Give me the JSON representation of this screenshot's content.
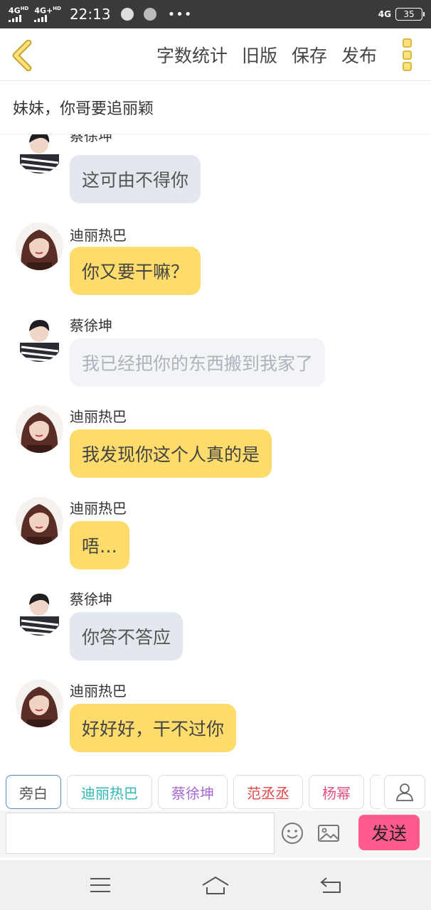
{
  "status_bar": {
    "net1": "4G",
    "net1_sup": "HD",
    "net2": "4G+",
    "net2_sup": "HD",
    "time": "22:13",
    "net3": "4G",
    "battery": "35"
  },
  "toolbar": {
    "word_count": "字数统计",
    "old_version": "旧版",
    "save": "保存",
    "publish": "发布"
  },
  "chat_title": "妹妹，你哥要追丽颖",
  "colors": {
    "yellow_bubble": "#fddc6c",
    "gray_bubble": "#e3e8ef",
    "send_button": "#ff5c8d",
    "role_dilireba": "#2fb8b4",
    "role_caixukun": "#a86ad0",
    "role_fanchengcheng": "#e04747",
    "role_yangmi": "#e0527c"
  },
  "messages": [
    {
      "sender": "蔡徐坤",
      "text": "这可由不得你",
      "style": "gray",
      "avatar": "male-avatar"
    },
    {
      "sender": "迪丽热巴",
      "text": "你又要干嘛？",
      "style": "yellow",
      "avatar": "female-avatar"
    },
    {
      "sender": "蔡徐坤",
      "text": "我已经把你的东西搬到我家了",
      "style": "faint",
      "avatar": "male-avatar"
    },
    {
      "sender": "迪丽热巴",
      "text": "我发现你这个人真的是",
      "style": "yellow",
      "avatar": "female-avatar"
    },
    {
      "sender": "迪丽热巴",
      "text": "唔…",
      "style": "yellow",
      "avatar": "female-avatar"
    },
    {
      "sender": "蔡徐坤",
      "text": "你答不答应",
      "style": "gray",
      "avatar": "male-avatar"
    },
    {
      "sender": "迪丽热巴",
      "text": "好好好，干不过你",
      "style": "yellow",
      "avatar": "female-avatar"
    }
  ],
  "roles": [
    {
      "label": "旁白",
      "active": true
    },
    {
      "label": "迪丽热巴",
      "active": false
    },
    {
      "label": "蔡徐坤",
      "active": false
    },
    {
      "label": "范丞丞",
      "active": false
    },
    {
      "label": "杨幂",
      "active": false
    }
  ],
  "input": {
    "value": "",
    "placeholder": ""
  },
  "send_label": "发送"
}
